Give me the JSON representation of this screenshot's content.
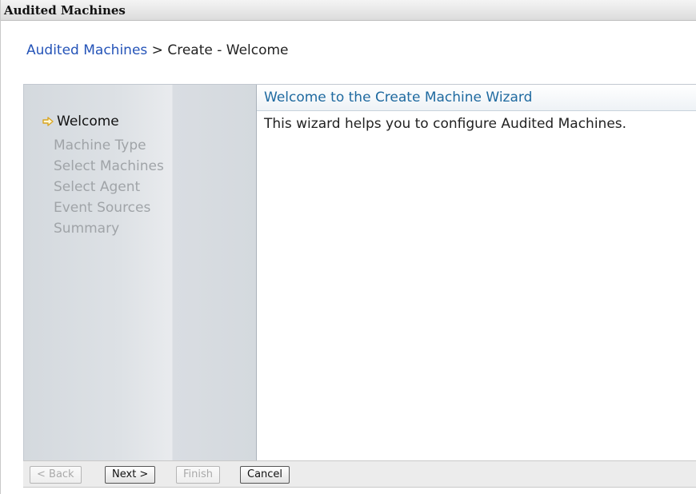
{
  "window": {
    "title": "Audited Machines"
  },
  "breadcrumb": {
    "link": "Audited Machines",
    "separator": " > ",
    "current": "Create - Welcome"
  },
  "wizard": {
    "steps": [
      {
        "label": "Welcome",
        "state": "current"
      },
      {
        "label": "Machine Type",
        "state": "pending"
      },
      {
        "label": "Select Machines",
        "state": "pending"
      },
      {
        "label": "Select Agent",
        "state": "pending"
      },
      {
        "label": "Event Sources",
        "state": "pending"
      },
      {
        "label": "Summary",
        "state": "pending"
      }
    ],
    "header": "Welcome to the Create Machine Wizard",
    "description": "This wizard helps you to configure Audited Machines.",
    "current_step_icon": "arrow-right-icon"
  },
  "buttons": {
    "back": "< Back",
    "next": "Next >",
    "finish": "Finish",
    "cancel": "Cancel"
  },
  "colors": {
    "link": "#2554b8",
    "header_text": "#1f6aa0",
    "disabled_text": "#a0a4a8",
    "arrow": "#e0b030"
  }
}
